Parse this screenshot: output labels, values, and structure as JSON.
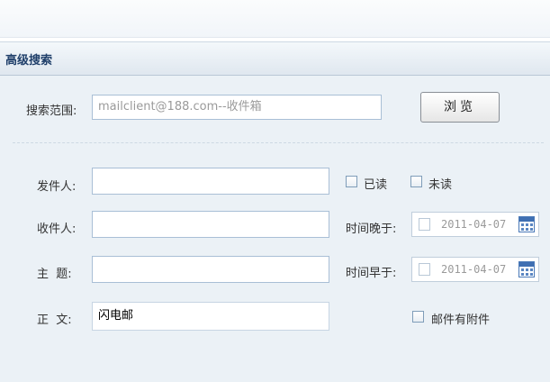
{
  "panel": {
    "title": "高级搜索"
  },
  "scope": {
    "label": "搜索范围:",
    "value": "mailclient@188.com--收件箱",
    "browse_label": "浏览"
  },
  "fields": {
    "sender_label": "发件人:",
    "sender_value": "",
    "recipient_label": "收件人:",
    "recipient_value": "",
    "subject_label": "主  题:",
    "subject_value": "",
    "body_label": "正  文:",
    "body_value": "闪电邮"
  },
  "filters": {
    "read_label": "已读",
    "unread_label": "未读",
    "later_than_label": "时间晚于:",
    "later_than_value": "2011-04-07",
    "earlier_than_label": "时间早于:",
    "earlier_than_value": "2011-04-07",
    "has_attachment_label": "邮件有附件"
  }
}
